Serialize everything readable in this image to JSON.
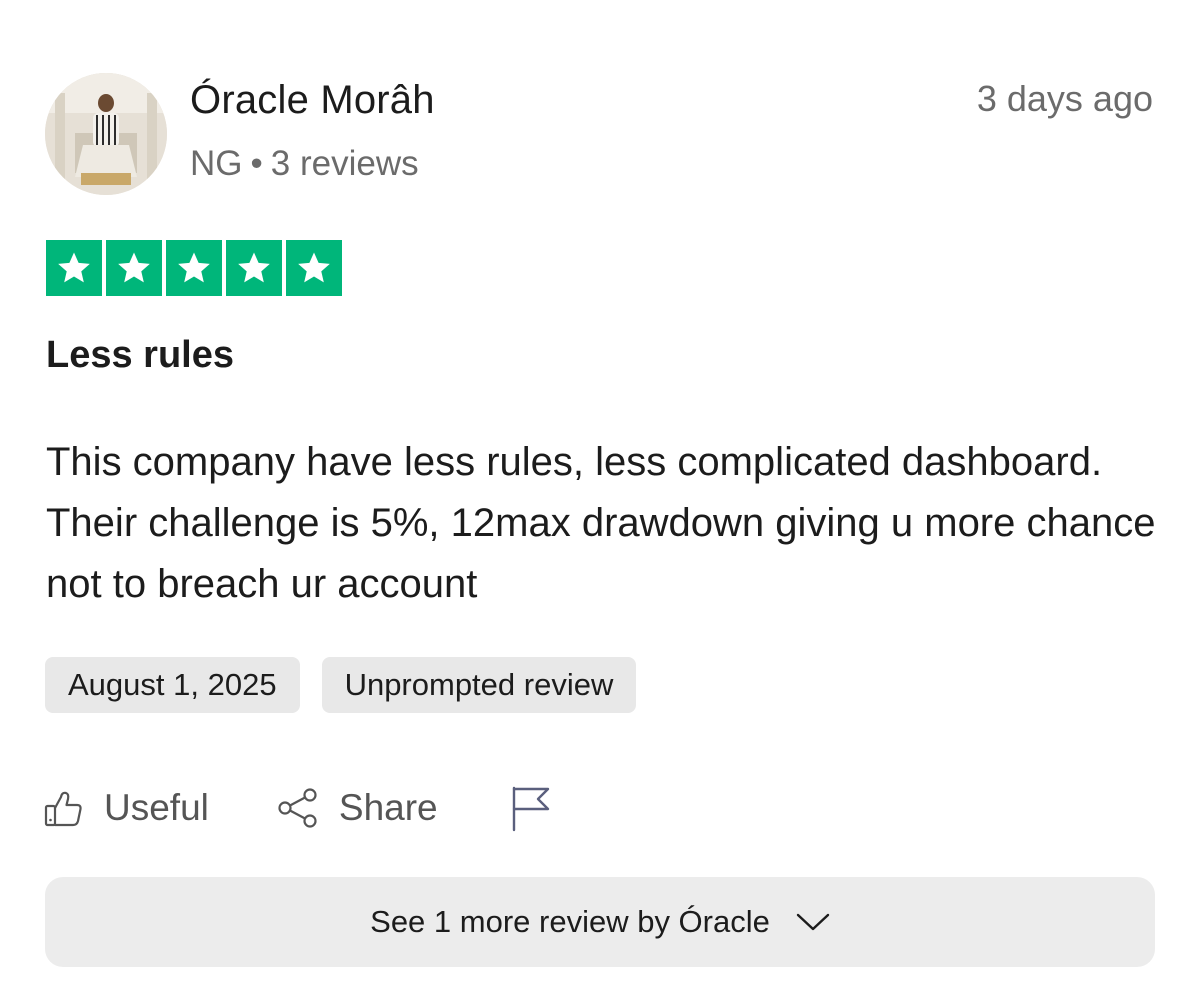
{
  "reviewer": {
    "name": "Óracle Morâh",
    "country": "NG",
    "separator": "•",
    "review_count": "3 reviews"
  },
  "timestamp": "3 days ago",
  "rating": {
    "stars": 5,
    "max": 5,
    "color": "#00b67a"
  },
  "review": {
    "title": "Less rules",
    "body": "This company have less rules, less complicated dashboard. Their challenge is 5%, 12max drawdown giving u more chance not to breach ur account"
  },
  "tags": {
    "date": "August 1, 2025",
    "type": "Unprompted review"
  },
  "actions": {
    "useful_label": "Useful",
    "useful_icon": "thumbs-up-icon",
    "share_label": "Share",
    "share_icon": "share-icon",
    "report_icon": "flag-icon"
  },
  "see_more": {
    "label": "See 1 more review by Óracle",
    "icon": "chevron-down-icon"
  }
}
